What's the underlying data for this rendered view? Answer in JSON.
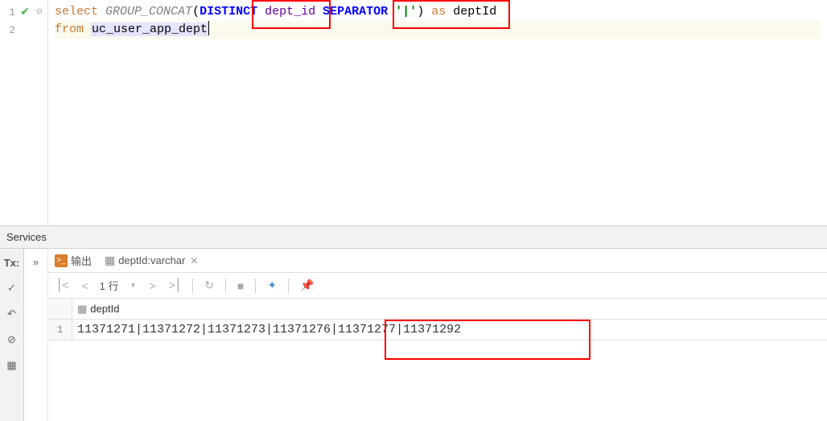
{
  "editor": {
    "lines": [
      {
        "num": "1",
        "hasCheck": true
      },
      {
        "num": "2",
        "hasCheck": false
      }
    ],
    "sql": {
      "select": "select",
      "group_concat": "GROUP_CONCAT",
      "distinct": "DISTINCT",
      "dept_id": "dept_id",
      "separator": "SEPARATOR",
      "sep_val": "'|'",
      "as": "as",
      "deptId": "deptId",
      "from": "from",
      "table": "uc_user_app_dept"
    }
  },
  "services": {
    "title": "Services",
    "tabs": {
      "output": "输出",
      "result": "deptId:varchar"
    },
    "toolbar": {
      "row_text": "1 行",
      "tx": "Tx:"
    },
    "grid": {
      "column": "deptId",
      "rownum": "1",
      "value": "11371271|11371272|11371273|11371276|11371277|11371292"
    }
  }
}
